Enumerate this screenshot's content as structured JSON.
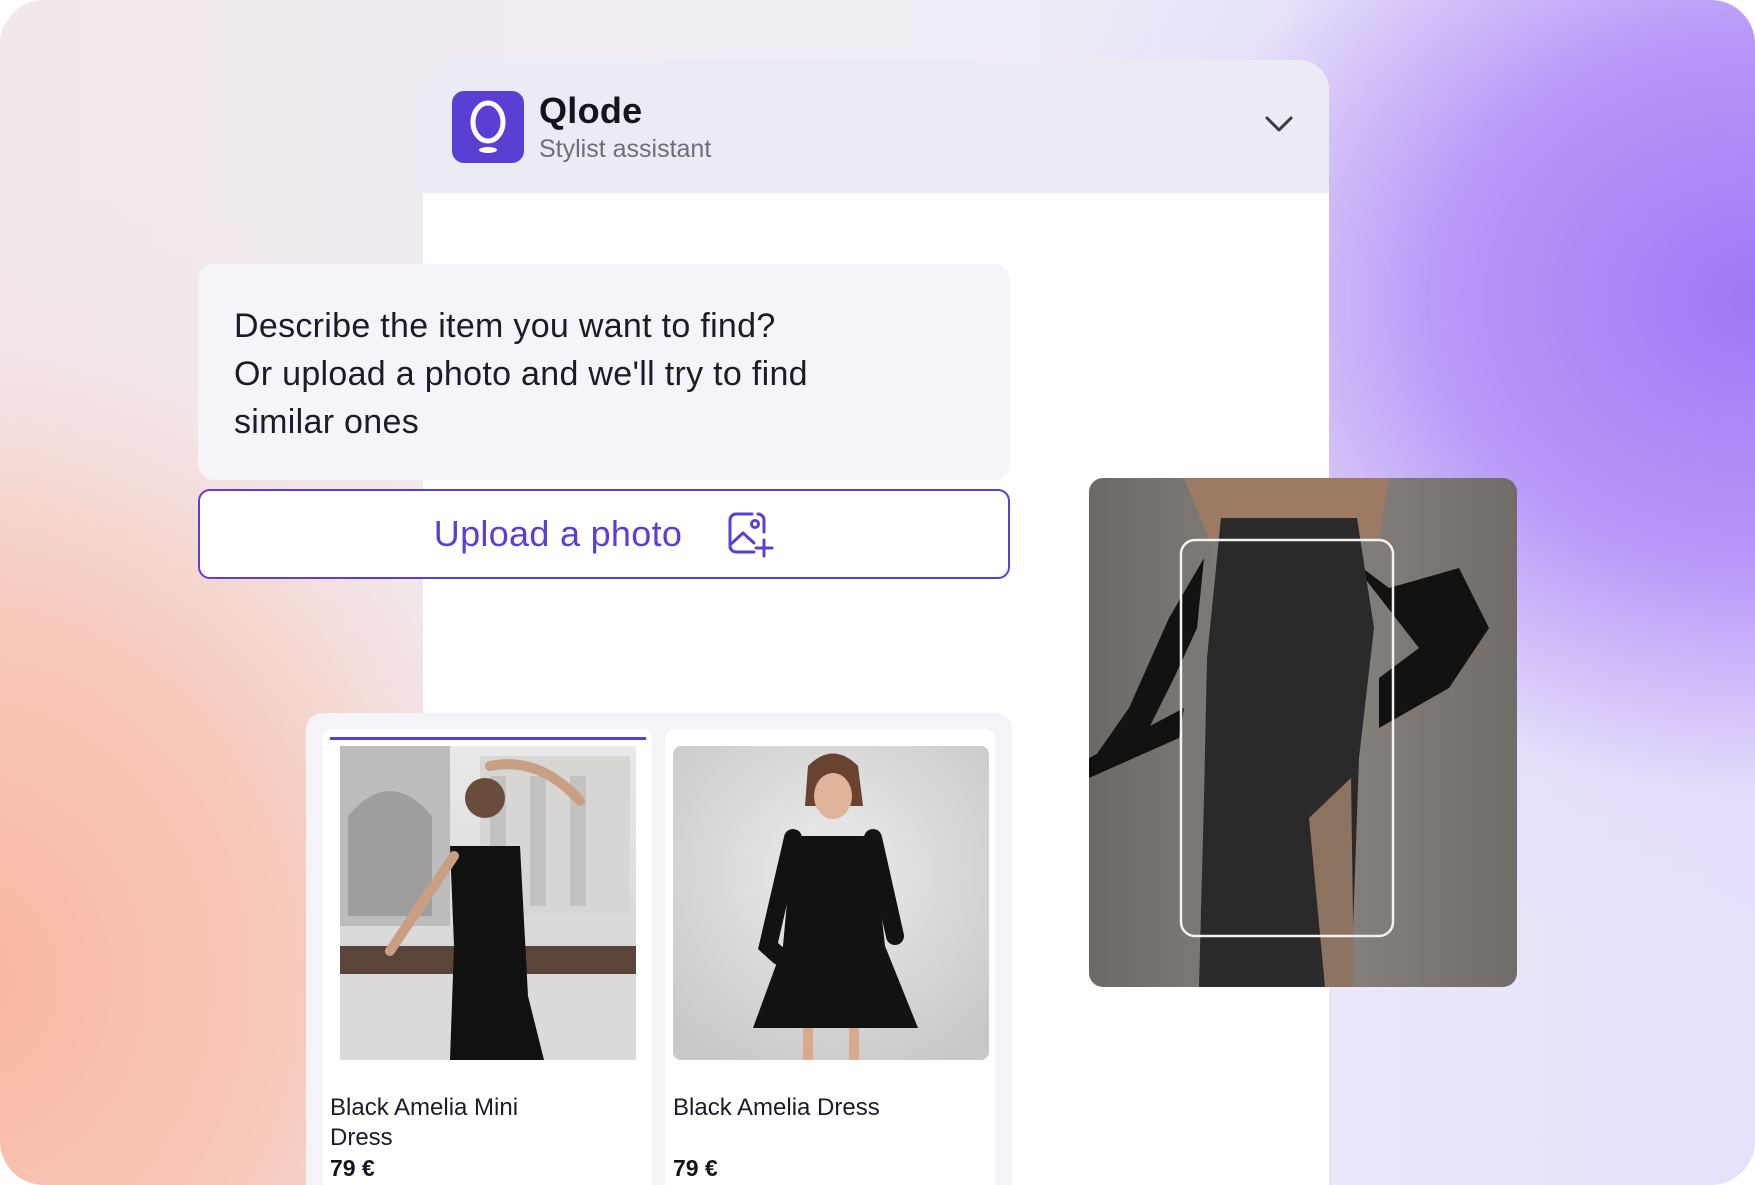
{
  "app": {
    "name": "Qlode",
    "subtitle": "Stylist assistant",
    "logo_letter": "Q"
  },
  "header": {
    "collapse_icon": "chevron-down-icon"
  },
  "message": {
    "lines": [
      "Describe the item you want to find?",
      "Or upload a photo and we'll try to find",
      "similar ones"
    ]
  },
  "upload": {
    "label": "Upload a photo",
    "icon": "image-add-icon"
  },
  "products": [
    {
      "name": "Black Amelia Mini Dress",
      "price": "79 €",
      "active": true
    },
    {
      "name": "Black Amelia Dress",
      "price": "79 €",
      "active": false
    }
  ],
  "colors": {
    "accent": "#5b3fd4",
    "header_bg": "#ebebf3",
    "message_bg": "#f4f4f9",
    "text": "#1b1b2a"
  }
}
